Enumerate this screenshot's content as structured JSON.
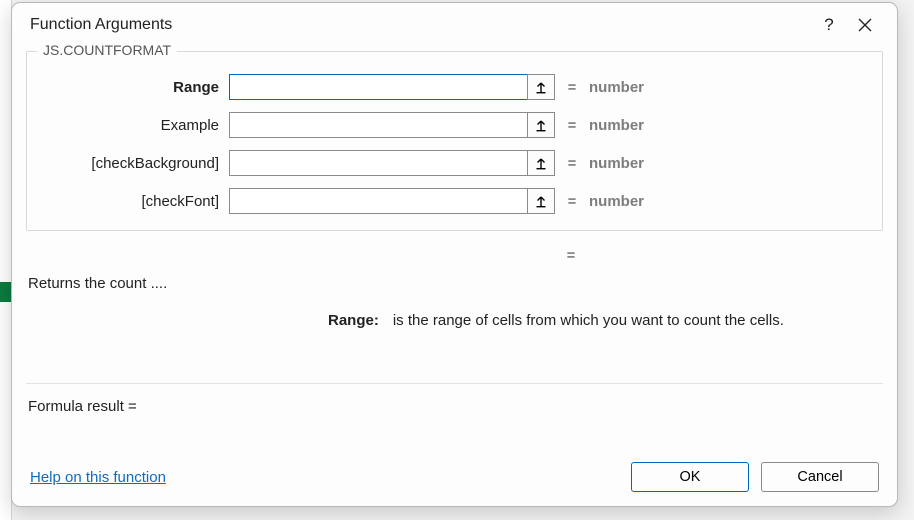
{
  "dialog": {
    "title": "Function Arguments",
    "help_icon": "?",
    "function_name": "JS.COUNTFORMAT",
    "args": [
      {
        "label": "Range",
        "required": true,
        "value": "",
        "type_hint": "number"
      },
      {
        "label": "Example",
        "required": false,
        "value": "",
        "type_hint": "number"
      },
      {
        "label": "[checkBackground]",
        "required": false,
        "value": "",
        "type_hint": "number"
      },
      {
        "label": "[checkFont]",
        "required": false,
        "value": "",
        "type_hint": "number"
      }
    ],
    "function_result_so_far": "",
    "short_description": "Returns the count ....",
    "active_arg": {
      "name": "Range:",
      "description": "is the range of cells from which you want to count the cells."
    },
    "formula_result_label": "Formula result =",
    "formula_result_value": "",
    "help_link": "Help on this function",
    "ok_label": "OK",
    "cancel_label": "Cancel",
    "equals_sign": "="
  }
}
